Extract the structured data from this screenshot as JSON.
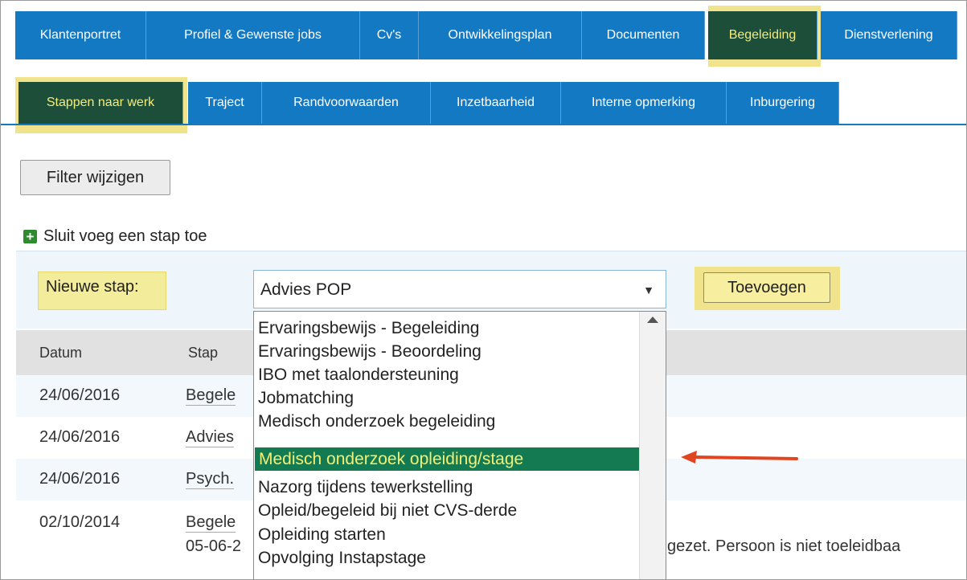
{
  "main_tabs": [
    {
      "label": "Klantenportret"
    },
    {
      "label": "Profiel & Gewenste jobs"
    },
    {
      "label": "Cv's"
    },
    {
      "label": "Ontwikkelingsplan"
    },
    {
      "label": "Documenten"
    },
    {
      "label": "Begeleiding",
      "active": true
    },
    {
      "label": "Dienstverlening"
    }
  ],
  "sub_tabs": [
    {
      "label": "Stappen naar werk",
      "active": true
    },
    {
      "label": "Traject"
    },
    {
      "label": "Randvoorwaarden"
    },
    {
      "label": "Inzetbaarheid"
    },
    {
      "label": "Interne opmerking"
    },
    {
      "label": "Inburgering"
    }
  ],
  "filter_button": "Filter wijzigen",
  "add_step_link": "Sluit voeg een stap toe",
  "form": {
    "label": "Nieuwe stap:",
    "selected_value": "Advies POP",
    "add_button": "Toevoegen"
  },
  "table": {
    "headers": [
      "Datum",
      "Stap"
    ],
    "rows": [
      {
        "date": "24/06/2016",
        "step": "Begele"
      },
      {
        "date": "24/06/2016",
        "step": "Advies"
      },
      {
        "date": "24/06/2016",
        "step": "Psych."
      },
      {
        "date": "02/10/2014",
        "step": "Begele",
        "sub": "05-06-2",
        "note": "gezet. Persoon is niet toeleidbaa"
      }
    ]
  },
  "dropdown_options": [
    "Ervaringsbewijs - Begeleiding",
    "Ervaringsbewijs - Beoordeling",
    "IBO met taalondersteuning",
    "Jobmatching",
    "Medisch onderzoek begeleiding",
    "Medisch onderzoek opleiding/stage",
    "Nazorg tijdens tewerkstelling",
    "Opleid/begeleid bij niet CVS-derde",
    "Opleiding starten",
    "Opvolging Instapstage"
  ],
  "dropdown_selected_index": 5,
  "colors": {
    "tab_blue": "#1479c3",
    "active_green": "#1d4e3a",
    "highlight_yellow": "#f1e38b",
    "selected_green": "#137a52",
    "arrow_red": "#e0451f"
  }
}
